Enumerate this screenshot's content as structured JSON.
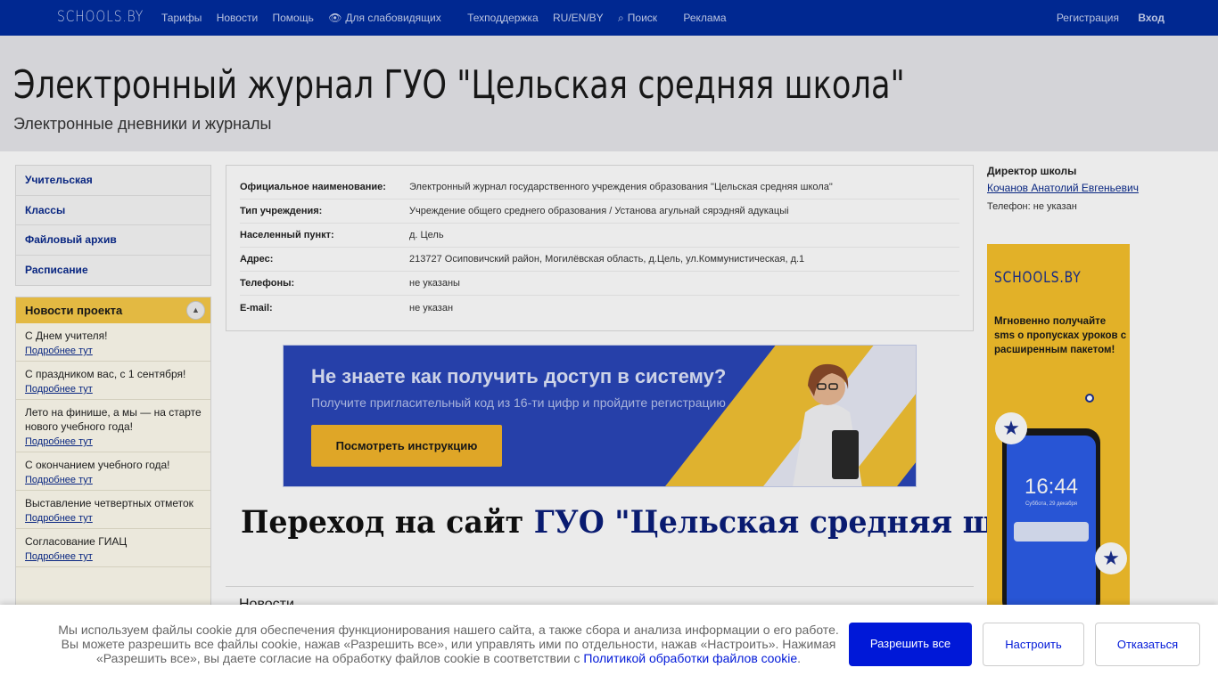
{
  "topbar": {
    "logo": "SCHOOLS.BY",
    "nav": {
      "tariffs": "Тарифы",
      "news": "Новости",
      "help": "Помощь",
      "visually_impaired": "Для слабовидящих",
      "support": "Техподдержка",
      "languages": "RU/EN/BY",
      "search": "Поиск",
      "ads": "Реклама"
    },
    "register": "Регистрация",
    "login": "Вход"
  },
  "header": {
    "title": "Электронный журнал ГУО \"Цельская средняя школа\"",
    "subtitle": "Электронные дневники и журналы"
  },
  "sidebar": {
    "items": [
      {
        "label": "Учительская"
      },
      {
        "label": "Классы"
      },
      {
        "label": "Файловый архив"
      },
      {
        "label": "Расписание"
      }
    ]
  },
  "project_news": {
    "title": "Новости проекта",
    "more_label": "Подробнее тут",
    "items": [
      {
        "title": "С Днем учителя!"
      },
      {
        "title": "С праздником вас, с 1 сентября!"
      },
      {
        "title": "Лето на финише, а мы — на старте нового учебного года!"
      },
      {
        "title": "С окончанием учебного года!"
      },
      {
        "title": "Выставление четвертных отметок"
      },
      {
        "title": "Согласование ГИАЦ"
      }
    ]
  },
  "info": {
    "rows": [
      {
        "key": "Официальное наименование:",
        "value": "Электронный журнал государственного учреждения образования \"Цельская средняя школа\""
      },
      {
        "key": "Тип учреждения:",
        "value": "Учреждение общего среднего образования / Установа агульнай сярэдняй адукацыі"
      },
      {
        "key": "Населенный пункт:",
        "value": "д. Цель"
      },
      {
        "key": "Адрес:",
        "value": "213727 Осиповичский район, Могилёвская область, д.Цель, ул.Коммунистическая, д.1"
      },
      {
        "key": "Телефоны:",
        "value": "не указаны"
      },
      {
        "key": "E-mail:",
        "value": "не указан"
      }
    ]
  },
  "banner": {
    "headline": "Не знаете как получить доступ в систему?",
    "subline": "Получите пригласительный код из 16-ти цифр и пройдите регистрацию",
    "button": "Посмотреть инструкцию"
  },
  "site_link": {
    "prefix": "Переход на сайт",
    "school": "ГУО \"Цельская средняя школа\""
  },
  "news_section_title": "Новости",
  "director": {
    "label": "Директор школы",
    "name": "Кочанов Анатолий Евгеньевич",
    "phone": "Телефон: не указан"
  },
  "ad": {
    "logo": "SCHOOLS.BY",
    "text": "Мгновенно получайте sms о пропусках уроков с расширенным пакетом!",
    "clock": "16:44",
    "date": "Суббота, 29 декабря"
  },
  "cookie": {
    "text": "Мы используем файлы cookie для обеспечения функционирования нашего сайта, а также сбора и анализа информации о его работе. Вы можете разрешить все файлы cookie, нажав «Разрешить все», или управлять ими по отдельности, нажав «Настроить». Нажимая «Разрешить все», вы даете согласие на обработку файлов cookie в соответствии с ",
    "link": "Политикой обработки файлов cookie",
    "tail": ".",
    "allow": "Разрешить все",
    "configure": "Настроить",
    "deny": "Отказаться"
  },
  "colors": {
    "topbar": "#002c9e",
    "accent": "#0018d8",
    "yellow": "#f6c02c"
  }
}
